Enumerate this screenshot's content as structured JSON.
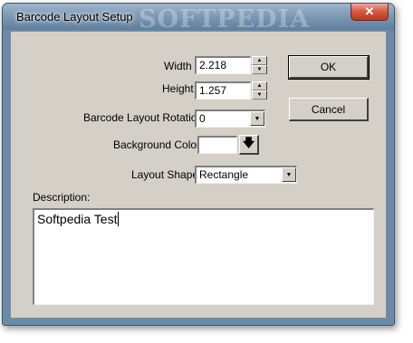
{
  "window": {
    "title": "Barcode Layout Setup",
    "watermark": "SOFTPEDIA",
    "close_label": "✕"
  },
  "form": {
    "width": {
      "label": "Width",
      "value": "2.218"
    },
    "height": {
      "label": "Height",
      "value": "1.257"
    },
    "rotation": {
      "label": "Barcode Layout Rotation",
      "value": "0"
    },
    "background": {
      "label": "Background Color",
      "swatch_color": "#ffffff"
    },
    "shape": {
      "label": "Layout Shape",
      "value": "Rectangle"
    },
    "description": {
      "label": "Description:",
      "value": "Softpedia Test"
    }
  },
  "buttons": {
    "ok": "OK",
    "cancel": "Cancel"
  },
  "icons": {
    "spin_up": "▲",
    "spin_down": "▼",
    "dropdown": "▼",
    "color_picker": "🡇"
  }
}
